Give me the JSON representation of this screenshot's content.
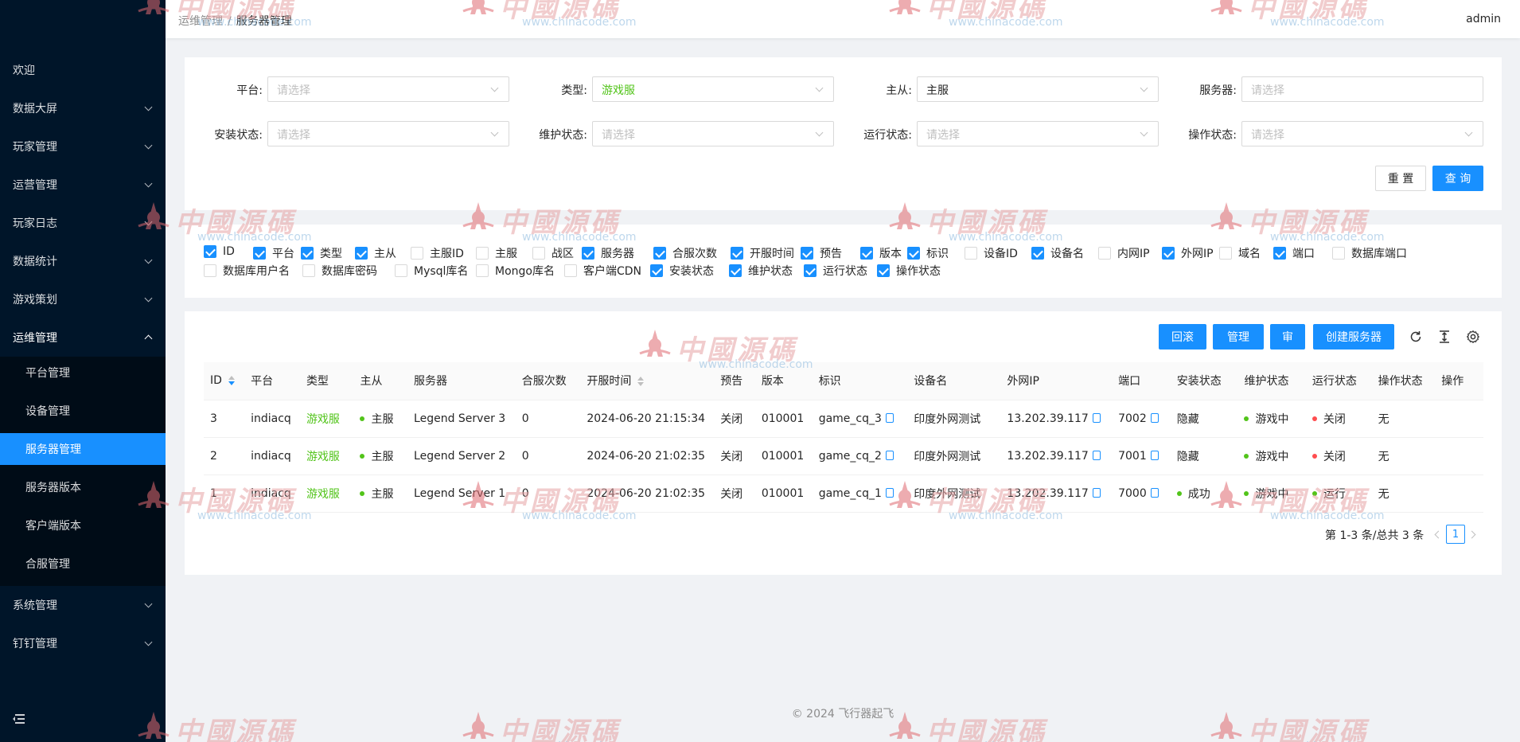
{
  "sidebar": {
    "items": [
      {
        "label": "欢迎"
      },
      {
        "label": "数据大屏"
      },
      {
        "label": "玩家管理"
      },
      {
        "label": "运营管理"
      },
      {
        "label": "玩家日志"
      },
      {
        "label": "数据统计"
      },
      {
        "label": "游戏策划"
      },
      {
        "label": "运维管理"
      },
      {
        "label": "系统管理"
      },
      {
        "label": "钉钉管理"
      }
    ],
    "submenu": [
      {
        "label": "平台管理"
      },
      {
        "label": "设备管理"
      },
      {
        "label": "服务器管理"
      },
      {
        "label": "服务器版本"
      },
      {
        "label": "客户端版本"
      },
      {
        "label": "合服管理"
      }
    ]
  },
  "header": {
    "breadcrumb": [
      "运维管理",
      "服务器管理"
    ],
    "breadcrumb_sep": "/",
    "user": "admin"
  },
  "filters": [
    {
      "label": "平台:",
      "value": "请选择"
    },
    {
      "label": "类型:",
      "value": "游戏服"
    },
    {
      "label": "主从:",
      "value": "主服"
    },
    {
      "label": "服务器:",
      "value": "请选择"
    },
    {
      "label": "安装状态:",
      "value": "请选择"
    },
    {
      "label": "维护状态:",
      "value": "请选择"
    },
    {
      "label": "运行状态:",
      "value": "请选择"
    },
    {
      "label": "操作状态:",
      "value": "请选择"
    }
  ],
  "filter_buttons": {
    "reset": "重 置",
    "query": "查 询"
  },
  "columns_row1": [
    {
      "label": "ID",
      "checked": true
    },
    {
      "label": "平台",
      "checked": true
    },
    {
      "label": "类型",
      "checked": true
    },
    {
      "label": "主从",
      "checked": true
    },
    {
      "label": "主服ID",
      "checked": false
    },
    {
      "label": "主服",
      "checked": false
    },
    {
      "label": "战区",
      "checked": false
    },
    {
      "label": "服务器",
      "checked": true
    },
    {
      "label": "合服次数",
      "checked": true
    },
    {
      "label": "开服时间",
      "checked": true
    },
    {
      "label": "预告",
      "checked": true
    },
    {
      "label": "版本",
      "checked": true
    },
    {
      "label": "标识",
      "checked": true
    },
    {
      "label": "设备ID",
      "checked": false
    },
    {
      "label": "设备名",
      "checked": true
    },
    {
      "label": "内网IP",
      "checked": false
    },
    {
      "label": "外网IP",
      "checked": true
    },
    {
      "label": "域名",
      "checked": false
    },
    {
      "label": "端口",
      "checked": true
    },
    {
      "label": "数据库端口",
      "checked": false
    }
  ],
  "columns_row2": [
    {
      "label": "数据库用户名",
      "checked": false
    },
    {
      "label": "数据库密码",
      "checked": false
    },
    {
      "label": "Mysql库名",
      "checked": false
    },
    {
      "label": "Mongo库名",
      "checked": false
    },
    {
      "label": "客户端CDN",
      "checked": false
    },
    {
      "label": "安装状态",
      "checked": true
    },
    {
      "label": "维护状态",
      "checked": true
    },
    {
      "label": "运行状态",
      "checked": true
    },
    {
      "label": "操作状态",
      "checked": true
    }
  ],
  "toolbar": {
    "rollback": "回滚",
    "manage": "管理",
    "review": "审",
    "create": "创建服务器"
  },
  "table": {
    "headers": [
      "ID",
      "平台",
      "类型",
      "主从",
      "服务器",
      "合服次数",
      "开服时间",
      "预告",
      "版本",
      "标识",
      "设备名",
      "外网IP",
      "端口",
      "安装状态",
      "维护状态",
      "运行状态",
      "操作状态",
      "操作"
    ],
    "rows": [
      {
        "id": "3",
        "platform": "indiacq",
        "type": "游戏服",
        "role": "主服",
        "server": "Legend Server 3",
        "merge": "0",
        "open_time": "2024-06-20 21:15:34",
        "notice": "关闭",
        "version": "010001",
        "tag": "game_cq_3",
        "device": "印度外网测试",
        "ip": "13.202.39.117",
        "port": "7002",
        "install": "隐藏",
        "maintain": "游戏中",
        "running": "关闭",
        "op": "无"
      },
      {
        "id": "2",
        "platform": "indiacq",
        "type": "游戏服",
        "role": "主服",
        "server": "Legend Server 2",
        "merge": "0",
        "open_time": "2024-06-20 21:02:35",
        "notice": "关闭",
        "version": "010001",
        "tag": "game_cq_2",
        "device": "印度外网测试",
        "ip": "13.202.39.117",
        "port": "7001",
        "install": "隐藏",
        "maintain": "游戏中",
        "running": "关闭",
        "op": "无"
      },
      {
        "id": "1",
        "platform": "indiacq",
        "type": "游戏服",
        "role": "主服",
        "server": "Legend Server 1",
        "merge": "0",
        "open_time": "2024-06-20 21:02:35",
        "notice": "关闭",
        "version": "010001",
        "tag": "game_cq_1",
        "device": "印度外网测试",
        "ip": "13.202.39.117",
        "port": "7000",
        "install": "成功",
        "maintain": "游戏中",
        "running": "运行",
        "op": "无"
      }
    ]
  },
  "pagination": {
    "summary": "第 1-3 条/总共 3 条",
    "current": "1"
  },
  "footer": "© 2024 飞行器起飞",
  "watermark": {
    "cn": "中國源碼",
    "url": "www.chinacode.com"
  },
  "colors": {
    "sidebar": "#001529",
    "submenu": "#000c17",
    "primary": "#1890ff",
    "success": "#52c41a",
    "error": "#ff4d4f"
  }
}
